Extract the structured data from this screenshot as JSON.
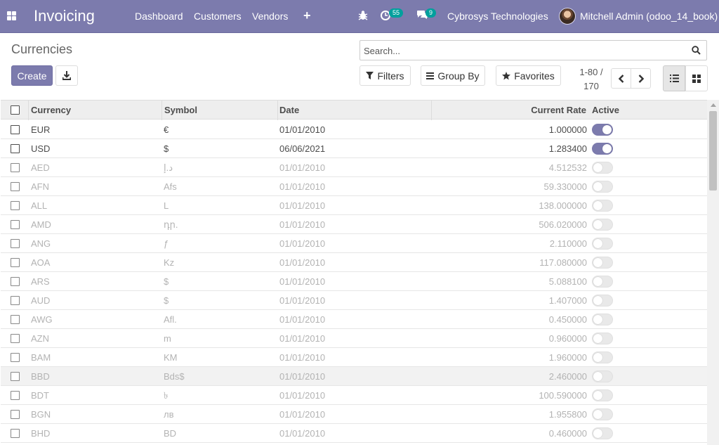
{
  "navbar": {
    "app_name": "Invoicing",
    "menu": [
      "Dashboard",
      "Customers",
      "Vendors"
    ],
    "plus_label": "+",
    "activity_count": "55",
    "message_count": "9",
    "company": "Cybrosys Technologies",
    "user": "Mitchell Admin (odoo_14_book)",
    "bg_color": "#7c7bad"
  },
  "control": {
    "breadcrumb": "Currencies",
    "create_label": "Create",
    "search_placeholder": "Search...",
    "filters_label": "Filters",
    "groupby_label": "Group By",
    "favorites_label": "Favorites",
    "pager_range": "1-80 /",
    "pager_total": "170"
  },
  "table": {
    "headers": {
      "currency": "Currency",
      "symbol": "Symbol",
      "date": "Date",
      "rate": "Current Rate",
      "active": "Active"
    },
    "rows": [
      {
        "currency": "EUR",
        "symbol": "€",
        "date": "01/01/2010",
        "rate": "1.000000",
        "active": true
      },
      {
        "currency": "USD",
        "symbol": "$",
        "date": "06/06/2021",
        "rate": "1.283400",
        "active": true
      },
      {
        "currency": "AED",
        "symbol": "د.إ",
        "date": "01/01/2010",
        "rate": "4.512532",
        "active": false
      },
      {
        "currency": "AFN",
        "symbol": "Afs",
        "date": "01/01/2010",
        "rate": "59.330000",
        "active": false
      },
      {
        "currency": "ALL",
        "symbol": "L",
        "date": "01/01/2010",
        "rate": "138.000000",
        "active": false
      },
      {
        "currency": "AMD",
        "symbol": "դր.",
        "date": "01/01/2010",
        "rate": "506.020000",
        "active": false
      },
      {
        "currency": "ANG",
        "symbol": "ƒ",
        "date": "01/01/2010",
        "rate": "2.110000",
        "active": false
      },
      {
        "currency": "AOA",
        "symbol": "Kz",
        "date": "01/01/2010",
        "rate": "117.080000",
        "active": false
      },
      {
        "currency": "ARS",
        "symbol": "$",
        "date": "01/01/2010",
        "rate": "5.088100",
        "active": false
      },
      {
        "currency": "AUD",
        "symbol": "$",
        "date": "01/01/2010",
        "rate": "1.407000",
        "active": false
      },
      {
        "currency": "AWG",
        "symbol": "Afl.",
        "date": "01/01/2010",
        "rate": "0.450000",
        "active": false
      },
      {
        "currency": "AZN",
        "symbol": "m",
        "date": "01/01/2010",
        "rate": "0.960000",
        "active": false
      },
      {
        "currency": "BAM",
        "symbol": "KM",
        "date": "01/01/2010",
        "rate": "1.960000",
        "active": false
      },
      {
        "currency": "BBD",
        "symbol": "Bds$",
        "date": "01/01/2010",
        "rate": "2.460000",
        "active": false
      },
      {
        "currency": "BDT",
        "symbol": "৳",
        "date": "01/01/2010",
        "rate": "100.590000",
        "active": false
      },
      {
        "currency": "BGN",
        "symbol": "лв",
        "date": "01/01/2010",
        "rate": "1.955800",
        "active": false
      },
      {
        "currency": "BHD",
        "symbol": "BD",
        "date": "01/01/2010",
        "rate": "0.460000",
        "active": false
      }
    ]
  }
}
